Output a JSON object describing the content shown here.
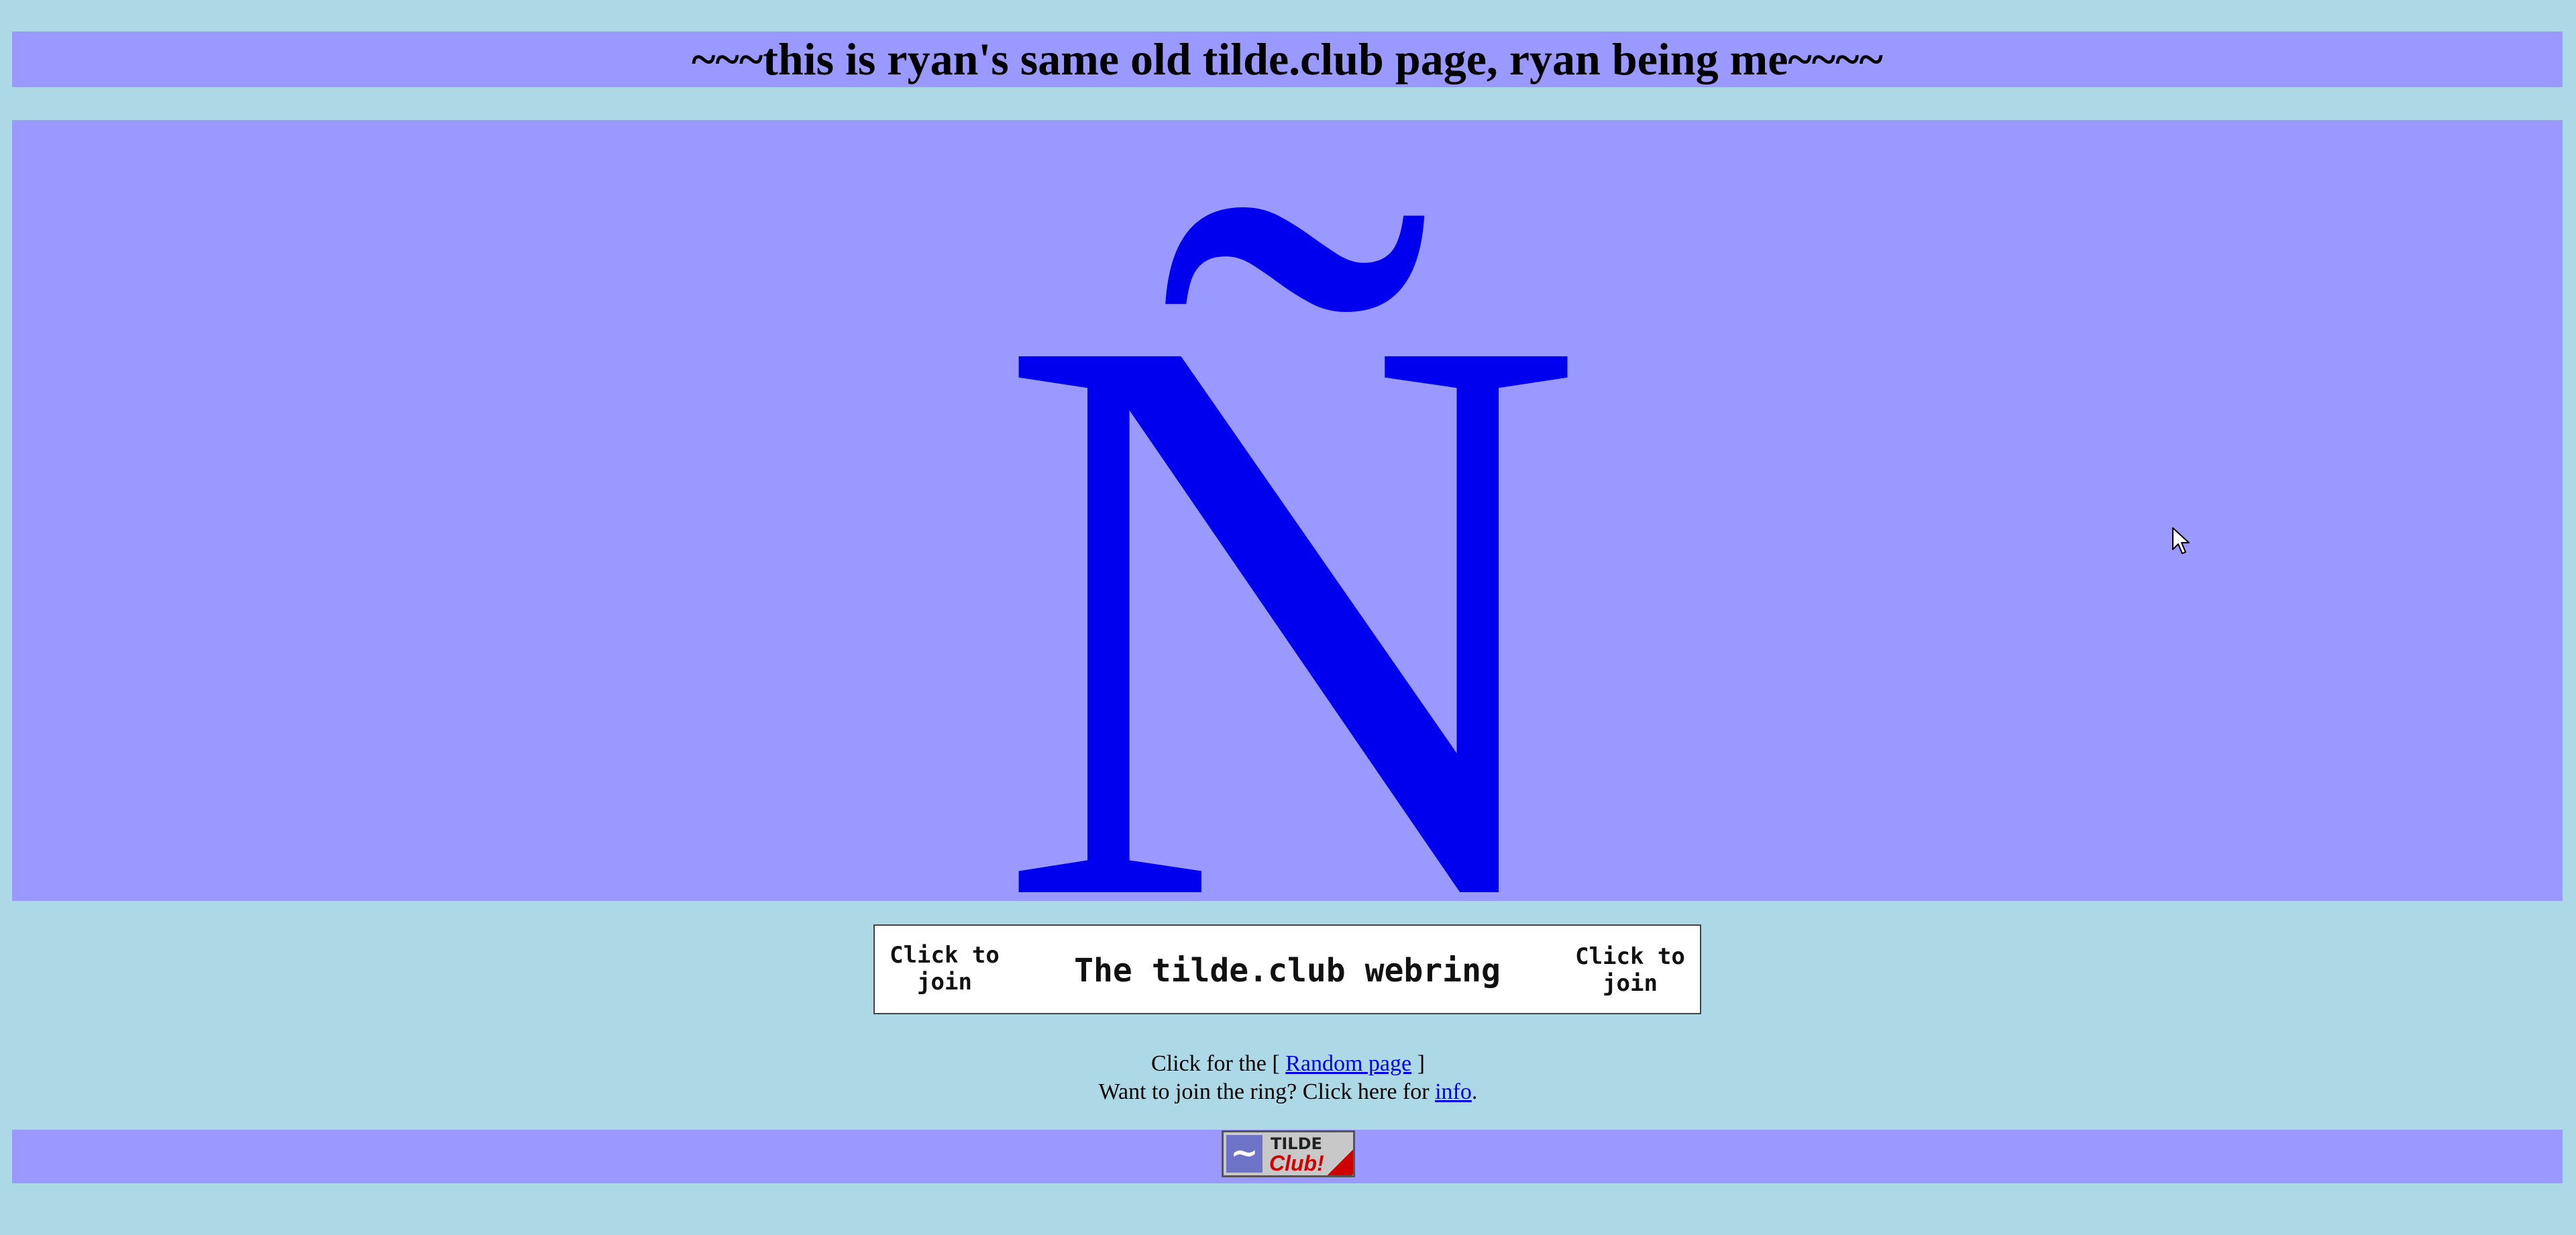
{
  "page": {
    "title": "~~~this is ryan's same old tilde.club page, ryan being me~~~~",
    "hero_glyph": "Ñ",
    "colors": {
      "background": "#add8e6",
      "band": "#9999ff",
      "link": "#0000ee"
    }
  },
  "webring": {
    "join_left": "Click to\njoin",
    "join_right": "Click to\njoin",
    "title": "The tilde.club webring",
    "random_prefix": "Click for the [ ",
    "random_link": "Random page",
    "random_suffix": " ]",
    "join_prefix": "Want to join the ring? Click here for ",
    "info_link": "info",
    "join_suffix": "."
  },
  "footer": {
    "badge_tilde": "~",
    "badge_word1": "TILDE",
    "badge_word2": "Club!",
    "badge_icon": "tilde-club-badge"
  },
  "cursor": {
    "icon": "mouse-pointer-icon"
  }
}
